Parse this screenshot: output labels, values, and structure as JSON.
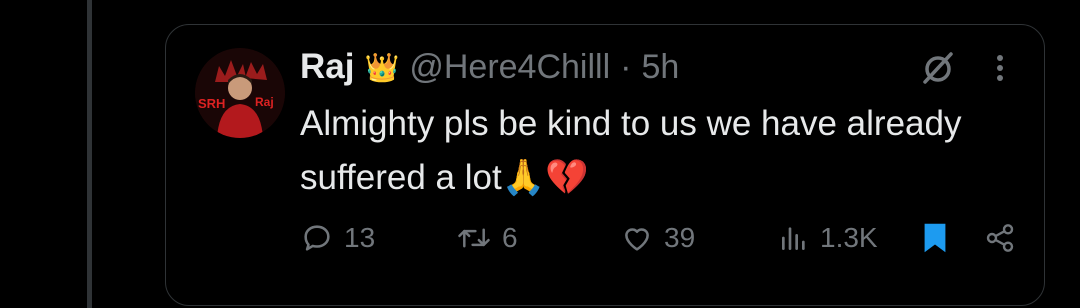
{
  "tweet": {
    "author_name": "Raj",
    "author_badge_emoji": "👑",
    "handle": "@Here4Chilll",
    "separator": "·",
    "time": "5h",
    "text": "Almighty pls be kind to us we have already suffered a lot🙏💔",
    "avatar_text_left": "SRH",
    "avatar_text_right": "Raj"
  },
  "metrics": {
    "replies": "13",
    "reposts": "6",
    "likes": "39",
    "views": "1.3K"
  },
  "icons": {
    "grok": "grok-icon",
    "more": "more-icon",
    "reply": "reply-icon",
    "repost": "repost-icon",
    "like": "heart-icon",
    "views": "views-icon",
    "bookmark": "bookmark-icon",
    "share": "share-icon"
  },
  "colors": {
    "background": "#000000",
    "text_primary": "#e7e9ea",
    "text_secondary": "#71767b",
    "border": "#2f3336",
    "bookmark_active": "#1d9bf0",
    "avatar_red": "#c0282a"
  }
}
